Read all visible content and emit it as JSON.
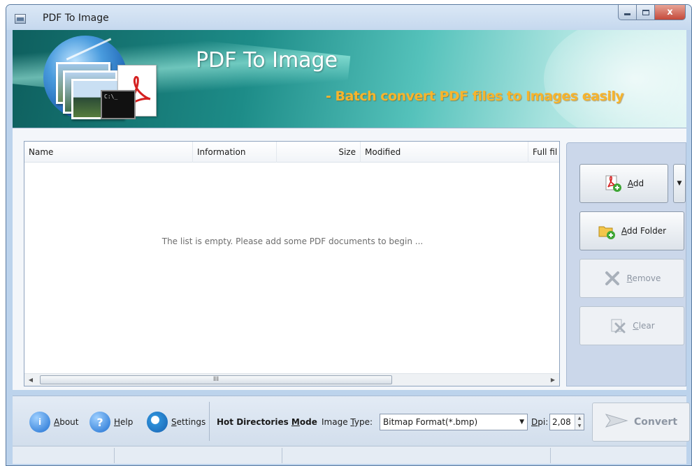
{
  "window": {
    "title": "PDF To Image",
    "close_glyph": "x"
  },
  "banner": {
    "title": "PDF To Image",
    "subtitle": "- Batch convert PDF files to Images easily",
    "logo_console_text": "C:\\_"
  },
  "file_list": {
    "columns": [
      "Name",
      "Information",
      "Size",
      "Modified",
      "Full fil"
    ],
    "empty_message": "The list is empty. Please add some PDF documents to begin ...",
    "scroll_grip": "III"
  },
  "side_buttons": {
    "add": {
      "label": "Add",
      "mnemonic": "A",
      "rest": "dd",
      "icon": "pdf-add-icon"
    },
    "add_folder": {
      "label": "Add Folder",
      "mnemonic": "A",
      "rest": "dd Folder",
      "icon": "folder-add-icon"
    },
    "remove": {
      "label": "Remove",
      "mnemonic": "R",
      "rest": "emove",
      "icon": "remove-x-icon"
    },
    "clear": {
      "label": "Clear",
      "mnemonic": "C",
      "rest": "lear",
      "icon": "clear-icon"
    }
  },
  "toolbar": {
    "about": {
      "mnemonic": "A",
      "rest": "bout"
    },
    "help": {
      "mnemonic": "H",
      "rest": "elp"
    },
    "settings": {
      "mnemonic": "S",
      "rest": "ettings"
    },
    "hot_mode": {
      "before": "Hot Directories ",
      "mnemonic": "M",
      "after": "ode"
    },
    "image_type": {
      "before": "Image ",
      "mnemonic": "T",
      "after": "ype:",
      "value": "Bitmap Format(*.bmp)"
    },
    "dpi": {
      "mnemonic": "D",
      "after": "pi:",
      "value": "2,08"
    },
    "convert_label": "Convert"
  },
  "colors": {
    "banner_subtitle": "#f7b42c",
    "accent": "#1d8c88"
  }
}
